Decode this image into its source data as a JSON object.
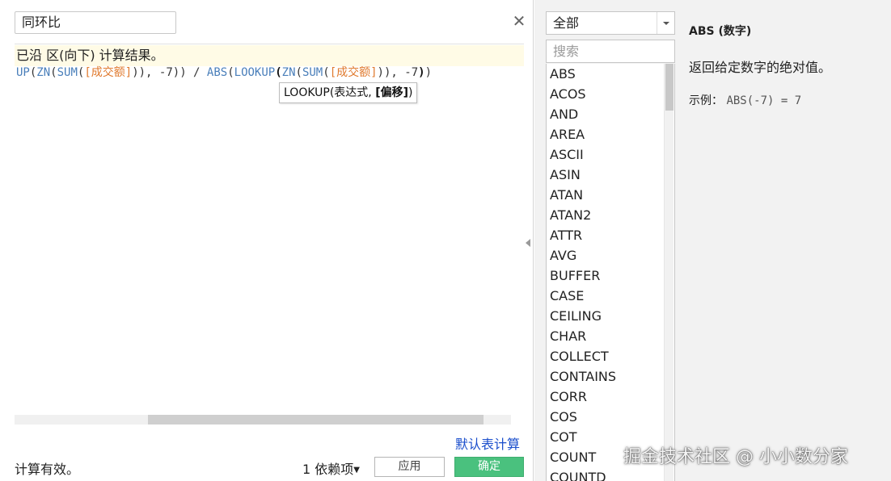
{
  "editor": {
    "name_value": "同环比",
    "status_message": "已沿 区(向下) 计算结果。",
    "formula_tokens": [
      {
        "t": "UP",
        "c": "fn"
      },
      {
        "t": "(",
        "c": "pun"
      },
      {
        "t": "ZN",
        "c": "fn"
      },
      {
        "t": "(",
        "c": "pun"
      },
      {
        "t": "SUM",
        "c": "fn"
      },
      {
        "t": "(",
        "c": "pun"
      },
      {
        "t": "[成交额]",
        "c": "fld"
      },
      {
        "t": ")), -7)) / ",
        "c": "pun"
      },
      {
        "t": "ABS",
        "c": "fn"
      },
      {
        "t": "(",
        "c": "pun"
      },
      {
        "t": "LOOKUP",
        "c": "fn"
      },
      {
        "t": "(",
        "c": "pun-b"
      },
      {
        "t": "ZN",
        "c": "fn"
      },
      {
        "t": "(",
        "c": "pun"
      },
      {
        "t": "SUM",
        "c": "fn"
      },
      {
        "t": "(",
        "c": "pun"
      },
      {
        "t": "[成交额]",
        "c": "fld"
      },
      {
        "t": ")), -7",
        "c": "pun"
      },
      {
        "t": ")",
        "c": "pun-b"
      },
      {
        "t": ")",
        "c": "pun"
      }
    ],
    "tooltip": {
      "prefix": "LOOKUP(表达式, ",
      "bold": "[偏移]",
      "suffix": ")"
    },
    "default_table_calc_label": "默认表计算",
    "valid_text": "计算有效。",
    "dependencies_label": "1 依赖项",
    "apply_label": "应用",
    "ok_label": "确定",
    "close_icon": "close-icon"
  },
  "functions_panel": {
    "category_selected": "全部",
    "search_placeholder": "搜索",
    "items": [
      "ABS",
      "ACOS",
      "AND",
      "AREA",
      "ASCII",
      "ASIN",
      "ATAN",
      "ATAN2",
      "ATTR",
      "AVG",
      "BUFFER",
      "CASE",
      "CEILING",
      "CHAR",
      "COLLECT",
      "CONTAINS",
      "CORR",
      "COS",
      "COT",
      "COUNT",
      "COUNTD"
    ]
  },
  "help": {
    "signature": "ABS (数字)",
    "description": "返回给定数字的绝对值。",
    "example_label": "示例：",
    "example_code": "ABS(-7) = 7"
  },
  "watermark": "掘金技术社区 @ 小小数分家",
  "colors": {
    "function_blue": "#4a7fba",
    "field_orange": "#e07a2e",
    "link_blue": "#1a4ecc",
    "ok_green": "#4ac17e",
    "banner_yellow": "#fffbe6"
  }
}
